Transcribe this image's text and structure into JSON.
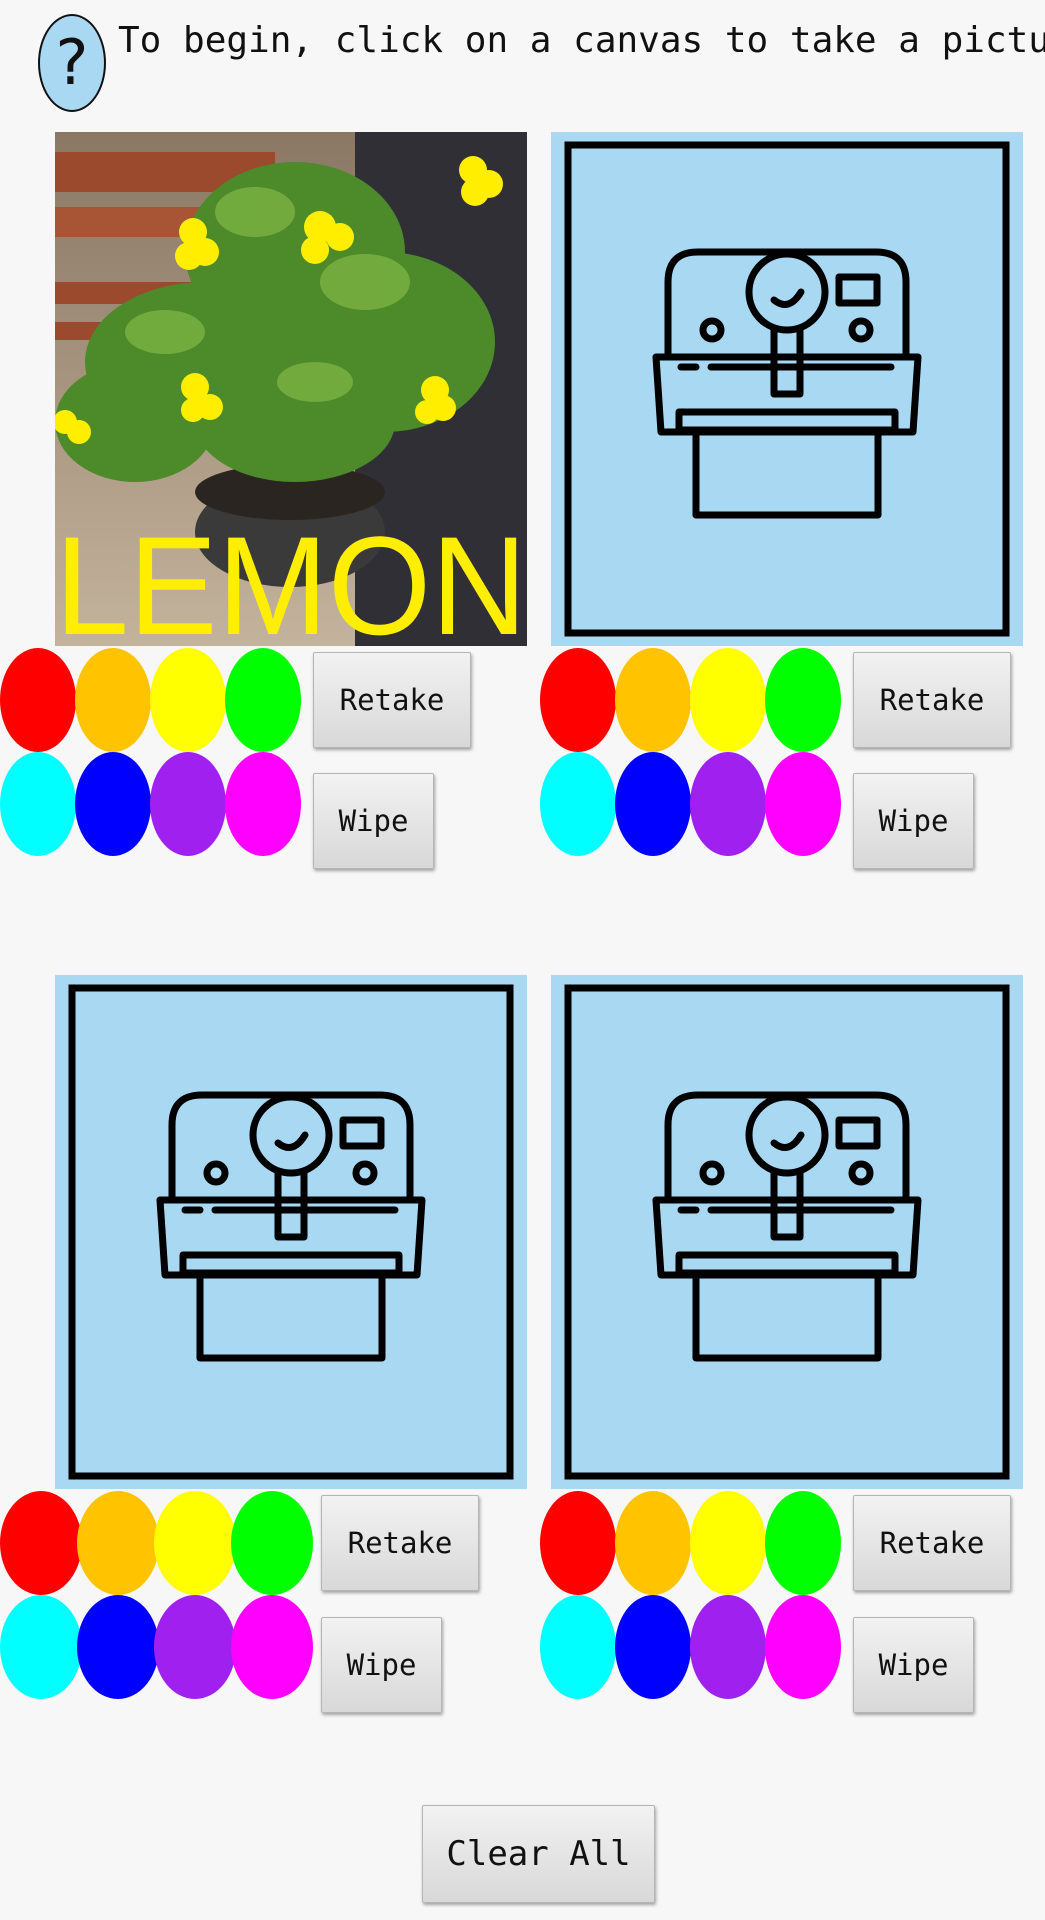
{
  "help": {
    "label": "?"
  },
  "instruction": "To begin, click on a canvas to take a picture",
  "canvases": [
    {
      "overlay_text": "LEMON",
      "retake_label": "Retake",
      "wipe_label": "Wipe"
    },
    {
      "retake_label": "Retake",
      "wipe_label": "Wipe"
    },
    {
      "retake_label": "Retake",
      "wipe_label": "Wipe"
    },
    {
      "retake_label": "Retake",
      "wipe_label": "Wipe"
    }
  ],
  "palette": {
    "red": "#ff0000",
    "orange": "#ffc300",
    "yellow": "#ffff00",
    "green": "#00ff00",
    "cyan": "#00ffff",
    "blue": "#0000ff",
    "purple": "#a020f0",
    "magenta": "#ff00ff"
  },
  "clear_all_label": "Clear All"
}
